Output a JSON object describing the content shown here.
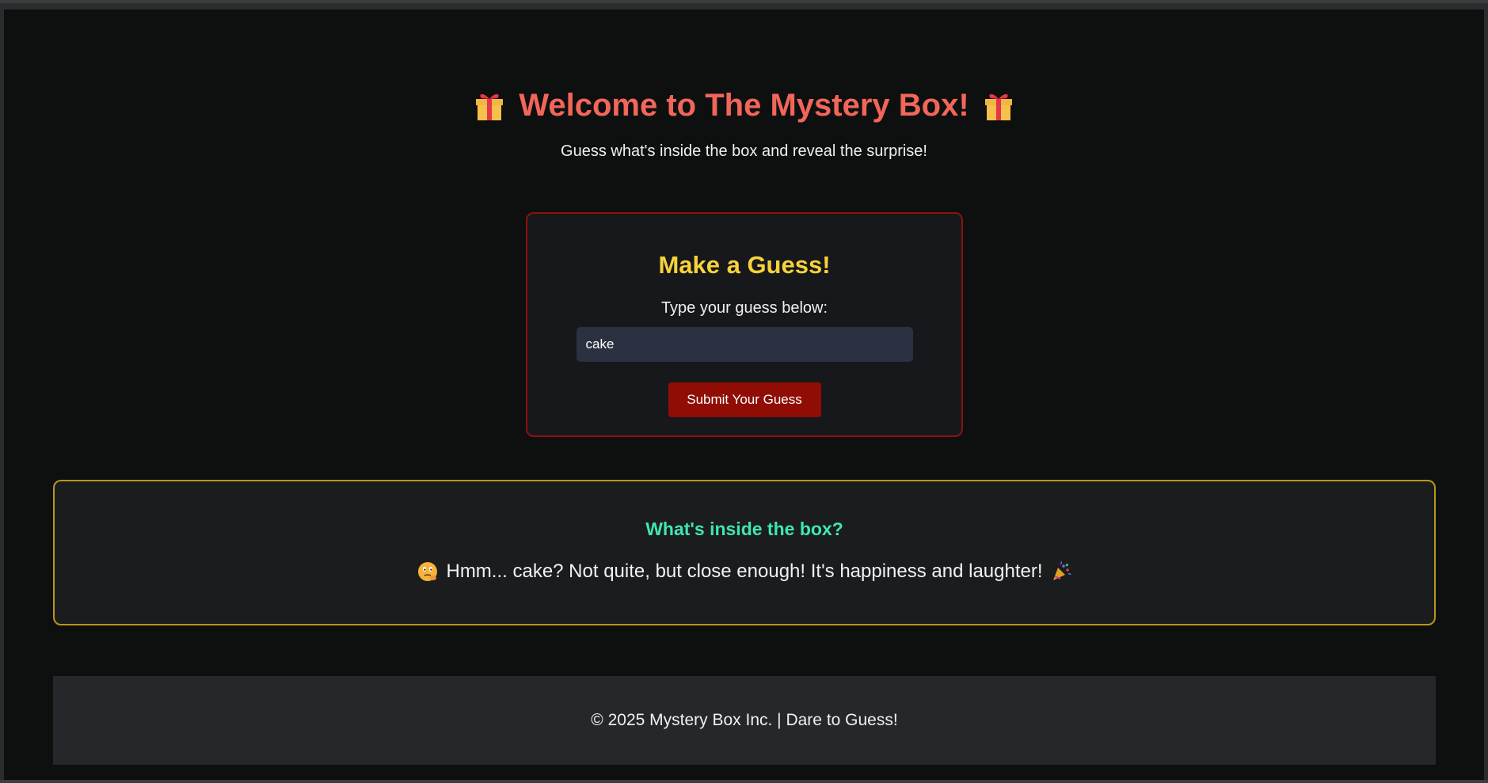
{
  "header": {
    "title": "Welcome to The Mystery Box!",
    "left_icon": "gift-icon",
    "right_icon": "gift-icon",
    "subtitle": "Guess what's inside the box and reveal the surprise!"
  },
  "guess_card": {
    "heading": "Make a Guess!",
    "prompt": "Type your guess below:",
    "input_value": "cake",
    "submit_label": "Submit Your Guess"
  },
  "reveal": {
    "heading": "What's inside the box?",
    "message": "Hmm... cake? Not quite, but close enough! It's happiness and laughter!",
    "left_icon": "thinking-face-icon",
    "right_icon": "party-popper-icon"
  },
  "footer": {
    "text": "© 2025 Mystery Box Inc. | Dare to Guess!"
  },
  "colors": {
    "title": "#f2665a",
    "card_heading": "#f7d23a",
    "reveal_heading": "#3ee6b5",
    "card_border": "#8f1010",
    "reveal_border": "#b9961a",
    "button": "#8f0d05",
    "background": "#0e1010"
  }
}
